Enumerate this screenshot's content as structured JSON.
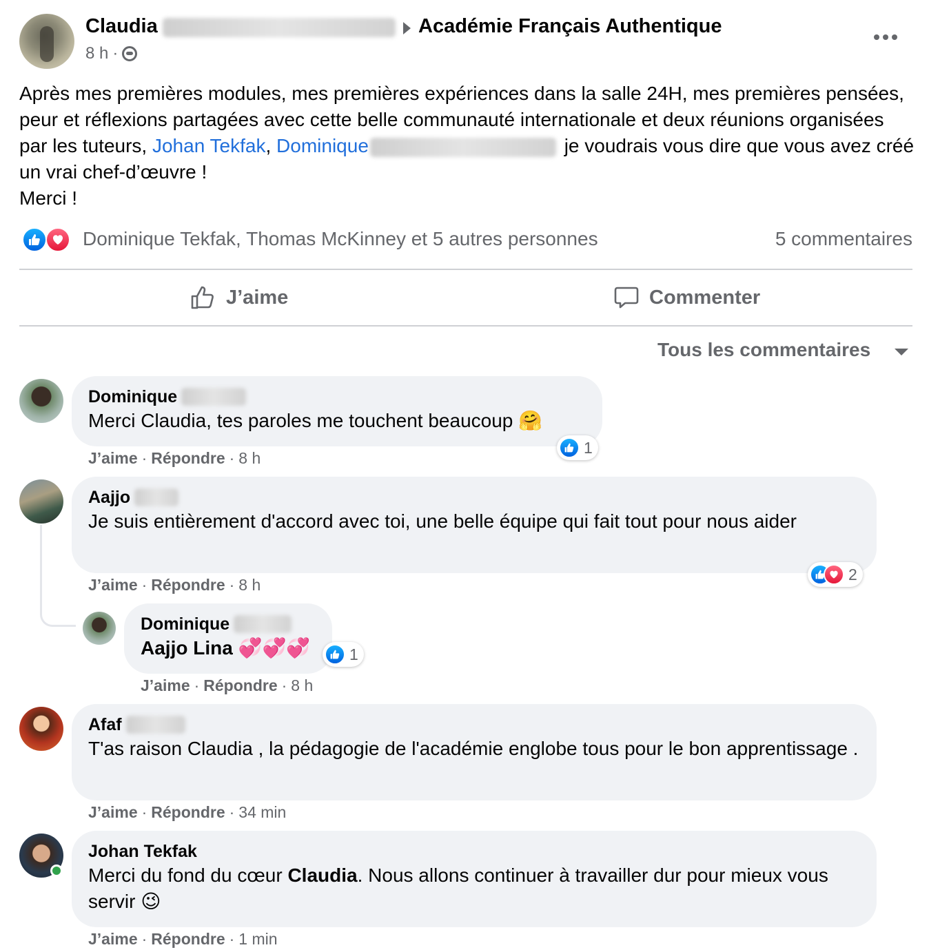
{
  "post": {
    "author": "Claudia",
    "group": "Académie Français Authentique",
    "time": "8 h",
    "dot": "·",
    "text_1": "Après mes premières modules, mes premières expériences dans la salle 24H, mes premières pensées, peur et réflexions partagées avec cette belle communauté internationale et deux réunions organisées par les tuteurs, ",
    "mention_1": "Johan Tekfak",
    "comma": ",",
    "mention_2": "Dominique",
    "text_2": "je voudrais vous dire que vous avez créé un vrai chef-d’œuvre !",
    "text_3": "Merci !"
  },
  "reactions": {
    "names": "Dominique Tekfak, Thomas McKinney et 5 autres personnes",
    "comments_count": "5 commentaires"
  },
  "actions": {
    "like": "J’aime",
    "comment": "Commenter"
  },
  "filter": {
    "label": "Tous les commentaires"
  },
  "comments": [
    {
      "name": "Dominique",
      "text": "Merci Claudia, tes paroles me touchent beaucoup",
      "emoji": "🤗",
      "like": "J’aime",
      "reply": "Répondre",
      "time": "8 h",
      "reaction_count": "1"
    },
    {
      "name": "Aajjo",
      "text": "Je suis entièrement d'accord avec toi, une belle équipe qui fait tout pour nous aider",
      "like": "J’aime",
      "reply": "Répondre",
      "time": "8 h",
      "reaction_count": "2"
    },
    {
      "name": "Dominique",
      "text": "Aajjo Lina",
      "emoji": "💞💞💞",
      "like": "J’aime",
      "reply": "Répondre",
      "time": "8 h",
      "reaction_count": "1"
    },
    {
      "name": "Afaf",
      "text": "T'as raison Claudia , la pédagogie de l'académie englobe tous pour le bon apprentissage .",
      "like": "J’aime",
      "reply": "Répondre",
      "time": "34 min"
    },
    {
      "name": "Johan Tekfak",
      "text_before": "Merci du fond du cœur ",
      "text_bold": "Claudia",
      "text_after": ". Nous allons continuer à travailler dur pour mieux vous servir",
      "emoji": "😉",
      "like": "J’aime",
      "reply": "Répondre",
      "time": "1 min"
    }
  ],
  "colors": {
    "link": "#216fdb",
    "secondary_text": "#65676b",
    "bubble": "#f0f2f5",
    "like_blue": "#0062df",
    "love_red": "#e61739",
    "online_green": "#31a24c"
  }
}
